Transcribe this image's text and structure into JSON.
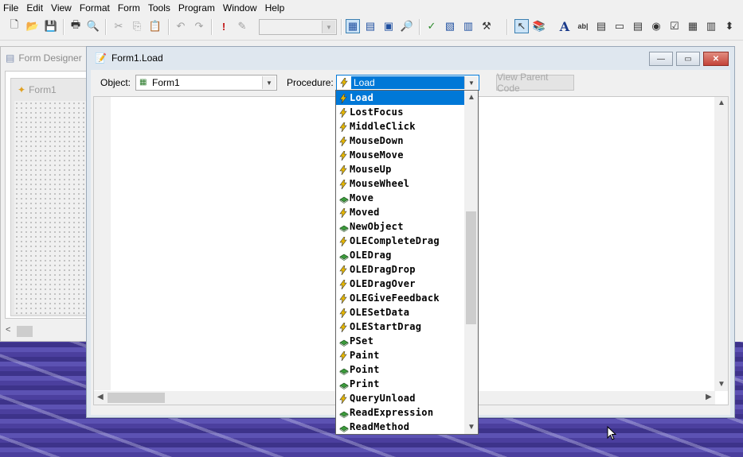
{
  "menubar": {
    "items": [
      "File",
      "Edit",
      "View",
      "Format",
      "Form",
      "Tools",
      "Program",
      "Window",
      "Help"
    ]
  },
  "toolbar": {
    "icons": [
      "new-file-icon",
      "open-folder-icon",
      "save-icon",
      "print-icon",
      "print-preview-icon",
      "cut-icon",
      "copy-icon",
      "paste-icon",
      "undo-icon",
      "redo-icon",
      "run-icon",
      "format-icon",
      "grid-view-icon",
      "code-window-icon",
      "properties-icon",
      "object-browser-icon",
      "check-icon",
      "edit-code-icon",
      "menu-editor-icon",
      "tools-icon",
      "pointer-icon",
      "library-icon",
      "label-icon",
      "textbox-icon",
      "listbox-icon",
      "button-icon",
      "frame-icon",
      "radio-icon",
      "checkbox-icon",
      "grid-icon",
      "combo-icon"
    ]
  },
  "form_designer": {
    "title": "Form Designer",
    "form_title": "Form1"
  },
  "code_window": {
    "title": "Form1.Load",
    "object_label": "Object:",
    "object_value": "Form1",
    "procedure_label": "Procedure:",
    "procedure_value": "Load",
    "view_parent_button": "View Parent Code"
  },
  "procedure_list": [
    {
      "name": "Load",
      "kind": "event",
      "selected": true
    },
    {
      "name": "LostFocus",
      "kind": "event"
    },
    {
      "name": "MiddleClick",
      "kind": "event"
    },
    {
      "name": "MouseDown",
      "kind": "event"
    },
    {
      "name": "MouseMove",
      "kind": "event"
    },
    {
      "name": "MouseUp",
      "kind": "event"
    },
    {
      "name": "MouseWheel",
      "kind": "event"
    },
    {
      "name": "Move",
      "kind": "method"
    },
    {
      "name": "Moved",
      "kind": "event"
    },
    {
      "name": "NewObject",
      "kind": "method"
    },
    {
      "name": "OLECompleteDrag",
      "kind": "event"
    },
    {
      "name": "OLEDrag",
      "kind": "method"
    },
    {
      "name": "OLEDragDrop",
      "kind": "event"
    },
    {
      "name": "OLEDragOver",
      "kind": "event"
    },
    {
      "name": "OLEGiveFeedback",
      "kind": "event"
    },
    {
      "name": "OLESetData",
      "kind": "event"
    },
    {
      "name": "OLEStartDrag",
      "kind": "event"
    },
    {
      "name": "PSet",
      "kind": "method"
    },
    {
      "name": "Paint",
      "kind": "event"
    },
    {
      "name": "Point",
      "kind": "method"
    },
    {
      "name": "Print",
      "kind": "method"
    },
    {
      "name": "QueryUnload",
      "kind": "event"
    },
    {
      "name": "ReadExpression",
      "kind": "method"
    },
    {
      "name": "ReadMethod",
      "kind": "method"
    }
  ],
  "colors": {
    "selection": "#0078d7",
    "event_icon": "#e8b800",
    "method_icon": "#3a9a3a"
  }
}
